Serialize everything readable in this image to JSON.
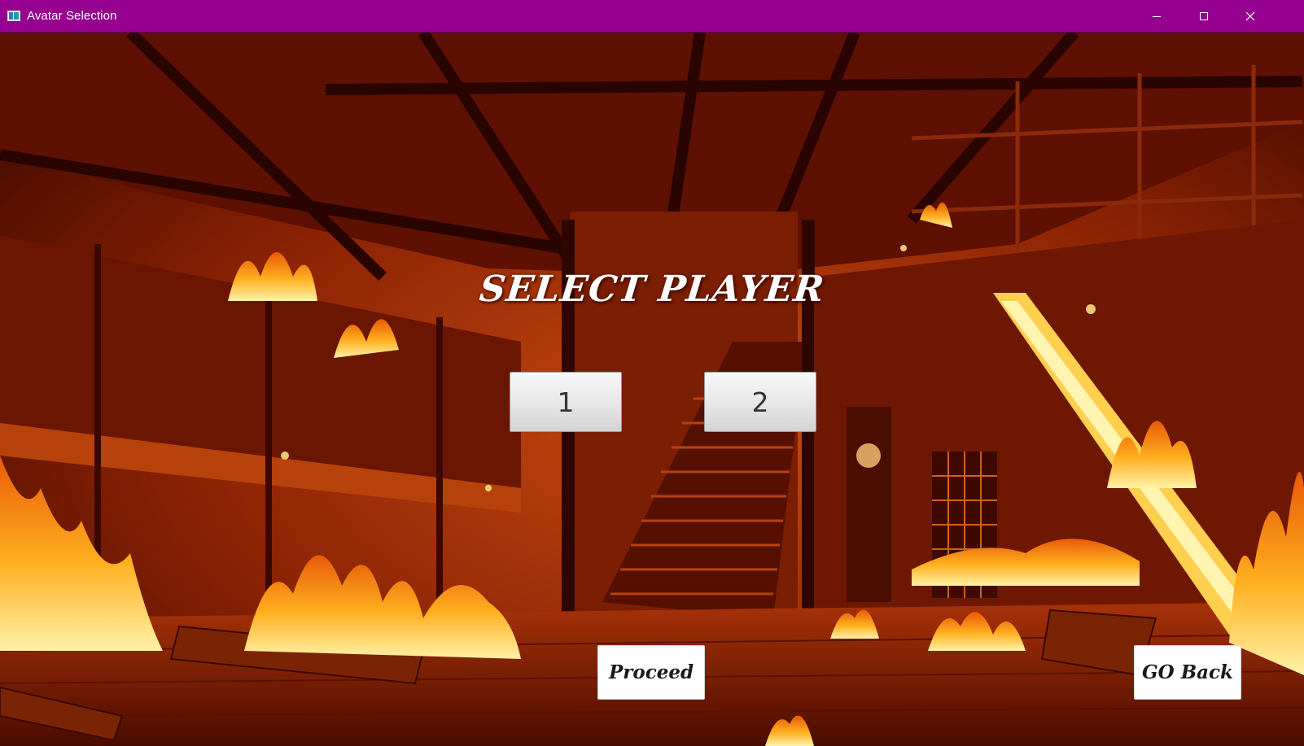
{
  "window": {
    "title": "Avatar Selection",
    "titlebar_color": "#95008f",
    "icon": "app-window-icon",
    "controls": [
      "minimize-icon",
      "maximize-icon",
      "close-icon"
    ]
  },
  "background": {
    "icon": "burning-room-scene",
    "palette": [
      "#2a0500",
      "#7a1800",
      "#c53a06",
      "#f07a10",
      "#ffe07a"
    ]
  },
  "screen": {
    "heading": "SELECT PLAYER",
    "player_options": [
      "1",
      "2"
    ],
    "proceed_label": "Proceed",
    "go_back_label": "GO Back"
  }
}
